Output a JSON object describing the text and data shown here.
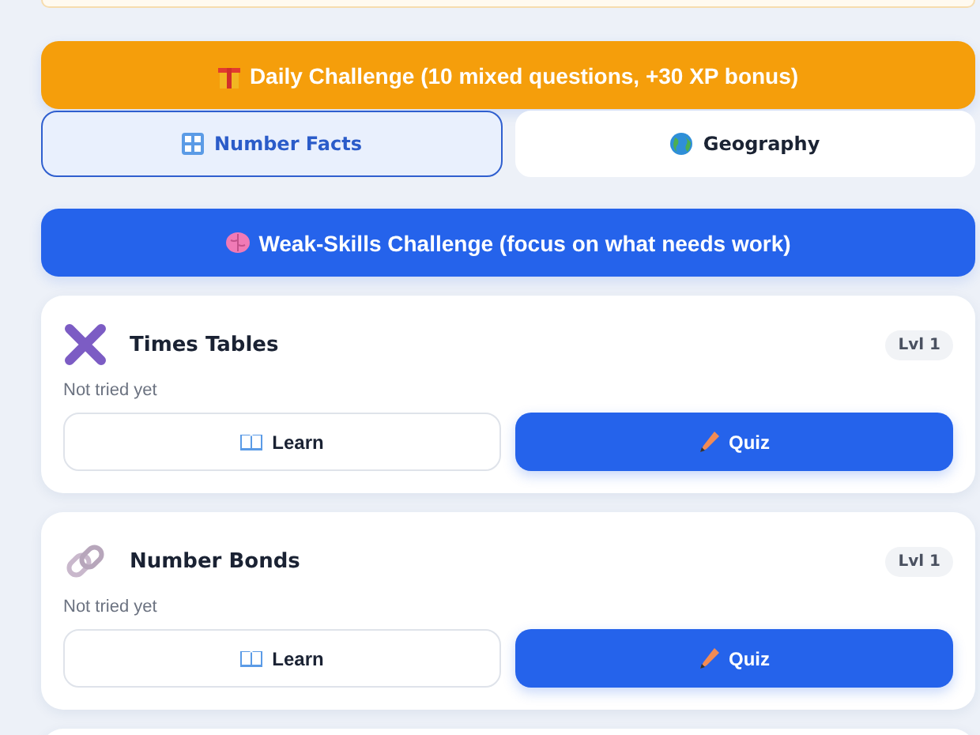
{
  "daily_button": {
    "label": "Daily Challenge (10 mixed questions, +30 XP bonus)"
  },
  "tabs": [
    {
      "label": "Number Facts",
      "kind": "keypad",
      "selected": true
    },
    {
      "label": "Geography",
      "kind": "globe",
      "selected": false
    }
  ],
  "weak_button": {
    "label": "Weak-Skills Challenge (focus on what needs work)"
  },
  "skills": [
    {
      "title": "Times Tables",
      "kind": "times",
      "status": "Not tried yet",
      "level": "Lvl 1",
      "learn": "Learn",
      "quiz": "Quiz"
    },
    {
      "title": "Number Bonds",
      "kind": "link",
      "status": "Not tried yet",
      "level": "Lvl 1",
      "learn": "Learn",
      "quiz": "Quiz"
    }
  ]
}
